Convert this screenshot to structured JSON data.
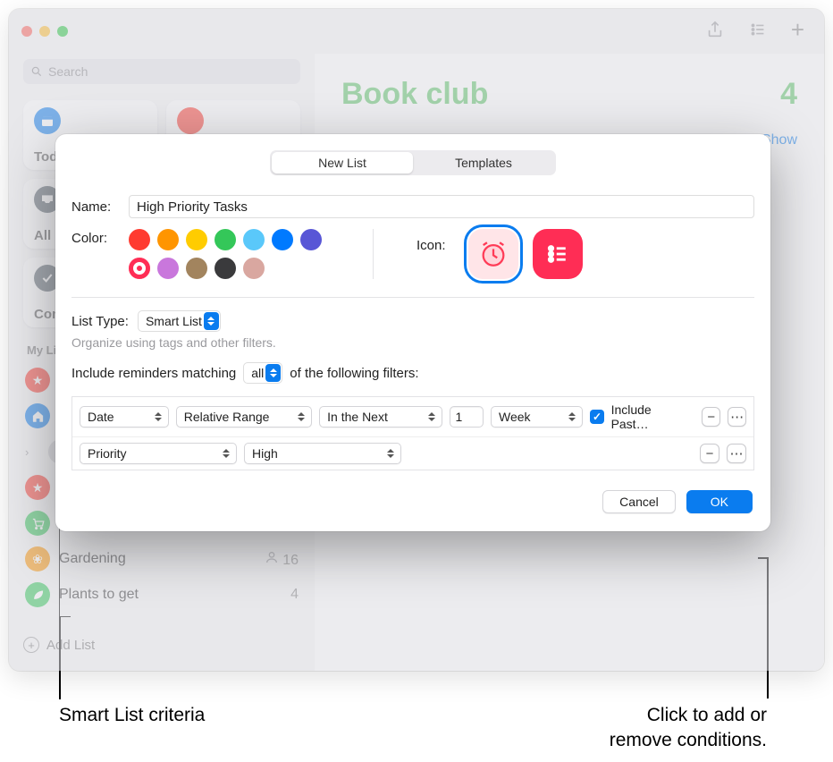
{
  "traffic": {
    "close": "",
    "min": "",
    "max": ""
  },
  "toolbar": {
    "share": "share-icon",
    "list": "list-icon",
    "add": "+"
  },
  "search": {
    "placeholder": "Search"
  },
  "tiles": [
    {
      "label": "Today",
      "color": "#0a7cef"
    },
    {
      "label": "",
      "color": "#ff3b30"
    },
    {
      "label": "All",
      "color": "#5b6670"
    },
    {
      "label": "",
      "color": ""
    },
    {
      "label": "Completed",
      "color": "#5b6670"
    },
    {
      "label": "",
      "color": ""
    }
  ],
  "my_lists_label": "My Lists",
  "sidebar_items": [
    {
      "icon": "#ff3b30",
      "glyph": "★",
      "label": "",
      "count": ""
    },
    {
      "icon": "#0a7cef",
      "glyph": "🏠",
      "label": "",
      "count": ""
    },
    {
      "icon": "#8e8e93",
      "glyph": "",
      "label": "",
      "count": "",
      "disclosure": true
    },
    {
      "icon": "#ff3b30",
      "glyph": "★",
      "label": "",
      "count": ""
    },
    {
      "icon": "#34c759",
      "glyph": "🛒",
      "label": "",
      "count": ""
    },
    {
      "icon": "#ff9500",
      "glyph": "❀",
      "label": "Gardening",
      "count": "16",
      "shared": true
    },
    {
      "icon": "#34c759",
      "glyph": "🍃",
      "label": "Plants to get",
      "count": "4"
    }
  ],
  "add_list_label": "Add List",
  "main": {
    "title": "Book club",
    "count": "4",
    "show": "Show"
  },
  "dialog": {
    "tabs": {
      "new": "New List",
      "templates": "Templates"
    },
    "name_label": "Name:",
    "name_value": "High Priority Tasks",
    "color_label": "Color:",
    "colors": [
      "#ff3b30",
      "#ff9500",
      "#ffcc00",
      "#34c759",
      "#5ac8fa",
      "#007aff",
      "#5856d6",
      "#ff2d55",
      "#af52de",
      "#a2845e",
      "#3a3a3c",
      "#d9a7a0"
    ],
    "icon_label": "Icon:",
    "list_type_label": "List Type:",
    "list_type_value": "Smart List",
    "hint": "Organize using tags and other filters.",
    "match_prefix": "Include reminders matching",
    "match_all": "all",
    "match_suffix": "of the following filters:",
    "filters": [
      {
        "field": "Date",
        "op": "Relative Range",
        "rel": "In the Next",
        "num": "1",
        "unit": "Week",
        "include_past": "Include Past…"
      },
      {
        "field": "Priority",
        "value": "High"
      }
    ],
    "cancel": "Cancel",
    "ok": "OK"
  },
  "annotations": {
    "criteria": "Smart List criteria",
    "addremove": "Click to add or\nremove conditions."
  }
}
